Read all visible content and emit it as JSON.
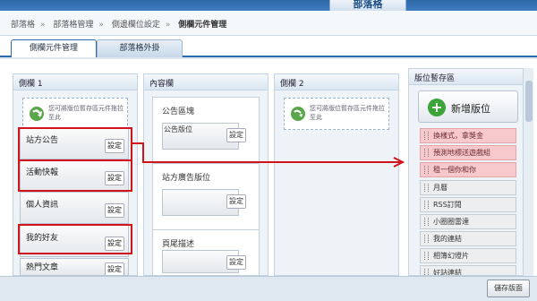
{
  "topbar": {
    "active_tab": "部落格"
  },
  "breadcrumb": {
    "items": [
      "部落格",
      "部落格管理",
      "側邊欄位設定",
      "側欄元件管理"
    ]
  },
  "tabs": [
    "側欄元件管理",
    "部落格外掛"
  ],
  "columns": [
    {
      "title": "側欄 1",
      "drop_text": "您可將版位暫存區元件拖拉至此",
      "widgets": [
        {
          "label": "站方公告",
          "button": "設定"
        },
        {
          "label": "活動快報",
          "button": "設定"
        },
        {
          "label": "個人資訊",
          "button": "設定"
        },
        {
          "label": "我的好友",
          "button": "設定"
        },
        {
          "label": "熱門文章",
          "button": "設定"
        }
      ]
    },
    {
      "title": "內容欄",
      "boxes": [
        {
          "title": "公告區塊",
          "widget": "公告版位",
          "button": "設定"
        },
        {
          "title": "站方廣告版位",
          "widget": "",
          "button": "設定"
        },
        {
          "title": "頁尾描述",
          "widget": "",
          "button": "設定"
        }
      ]
    },
    {
      "title": "側欄 2",
      "drop_text": "您可將版位暫存區元件拖拉至此"
    }
  ],
  "panel": {
    "title": "版位暫存區",
    "add_button": "新增版位",
    "items": [
      {
        "label": "換樣式，拿獎金",
        "highlight": true
      },
      {
        "label": "預測地標送遊戲組",
        "highlight": true
      },
      {
        "label": "租一個你和你",
        "highlight": true
      },
      {
        "label": "月曆",
        "highlight": false
      },
      {
        "label": "RSS訂閱",
        "highlight": false
      },
      {
        "label": "小圈圈雷達",
        "highlight": false
      },
      {
        "label": "我的連結",
        "highlight": false
      },
      {
        "label": "相簿幻燈片",
        "highlight": false
      },
      {
        "label": "好站連結",
        "highlight": false
      }
    ]
  },
  "save_button": "儲存版面",
  "colors": {
    "accent": "#2d6bb0",
    "annotation": "#d0141b",
    "highlight": "#f7c9cd",
    "add_icon": "#3ba53a"
  }
}
